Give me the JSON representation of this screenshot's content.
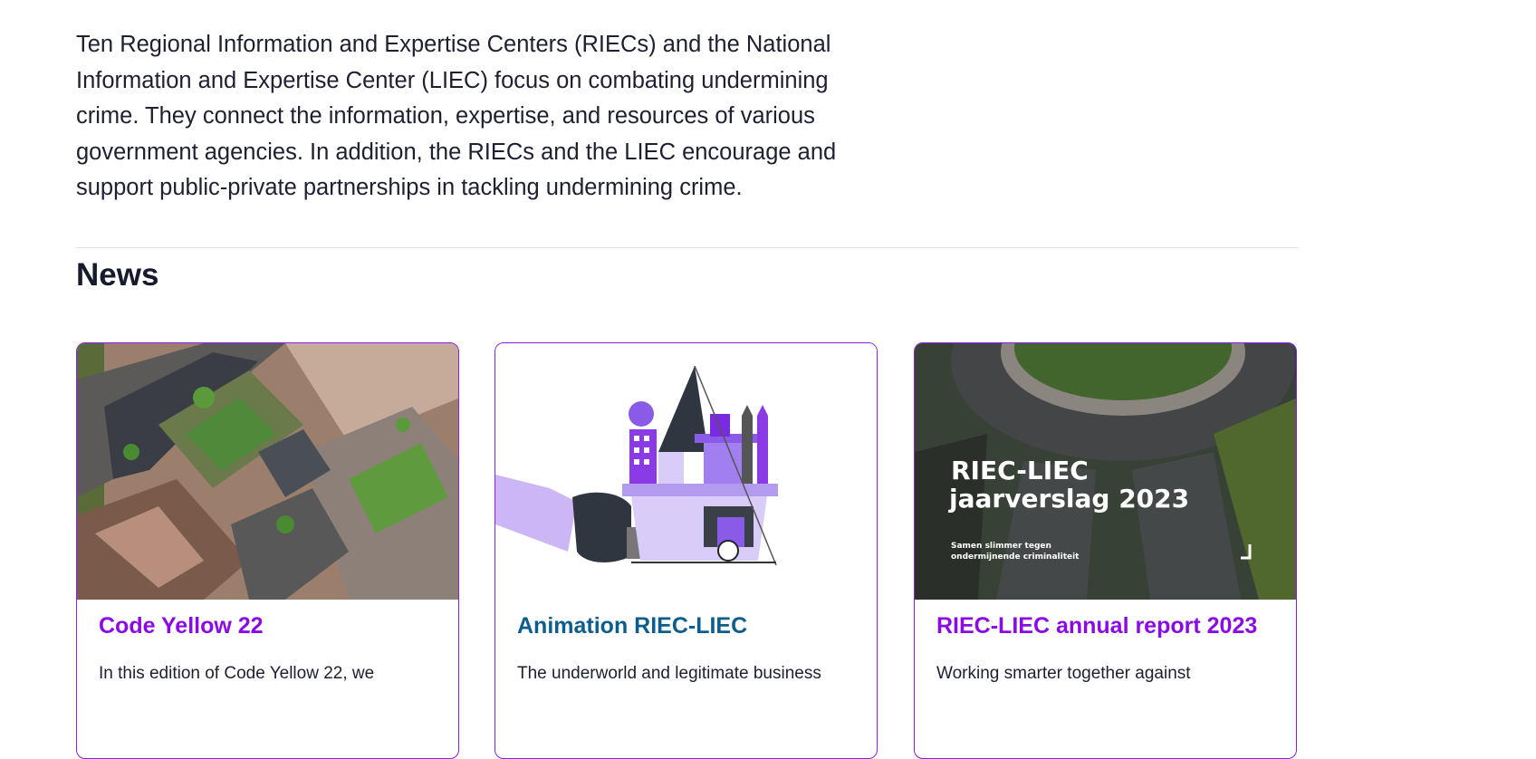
{
  "intro": {
    "text": "Ten Regional Information and Expertise Centers (RIECs) and the National Information and Expertise Center (LIEC) focus on combating undermining crime. They connect the information, expertise, and resources of various government agencies. In addition, the RIECs and the LIEC encourage and support public-private partnerships in tackling undermining crime."
  },
  "news": {
    "heading": "News",
    "cards": [
      {
        "title": "Code Yellow 22",
        "excerpt": "In this edition of Code Yellow 22, we",
        "image": "aerial-city-photo"
      },
      {
        "title": "Animation RIEC-LIEC",
        "excerpt": "The underworld and legitimate business",
        "image": "purple-illustration-hand-buildings"
      },
      {
        "title": "RIEC-LIEC annual report 2023",
        "excerpt": "Working smarter together against",
        "image": "aerial-roundabout-photo",
        "image_overlay": {
          "line1": "RIEC-LIEC",
          "line2": "jaarverslag 2023",
          "sub1": "Samen slimmer tegen",
          "sub2": "ondermijnende criminaliteit"
        }
      }
    ]
  },
  "colors": {
    "accent_purple": "#8a0be6",
    "teal_title": "#0d5e8c",
    "text": "#1c2030"
  }
}
